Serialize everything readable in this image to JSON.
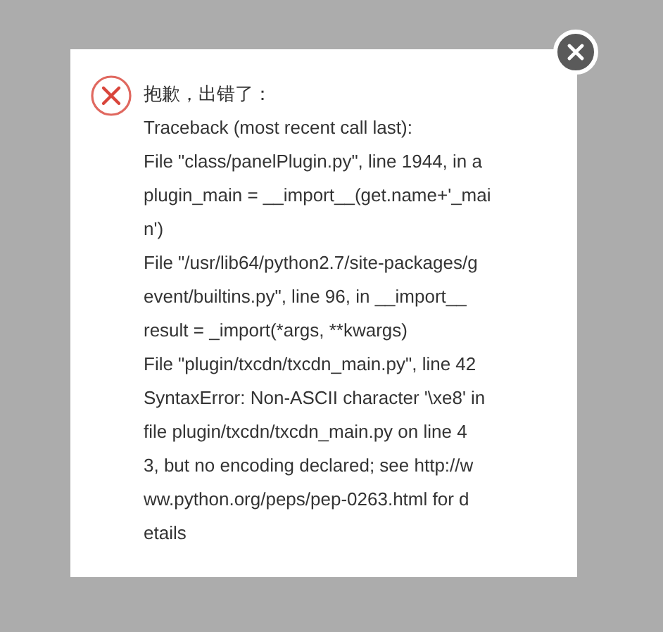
{
  "dialog": {
    "title": "抱歉，出错了：",
    "lines": [
      "Traceback (most recent call last):",
      "File \"class/panelPlugin.py\", line 1944, in a",
      "plugin_main = __import__(get.name+'_mai",
      "n')",
      "File \"/usr/lib64/python2.7/site-packages/g",
      "event/builtins.py\", line 96, in __import__",
      "result = _import(*args, **kwargs)",
      "File \"plugin/txcdn/txcdn_main.py\", line 42",
      "SyntaxError: Non-ASCII character '\\xe8' in",
      "file plugin/txcdn/txcdn_main.py on line 4",
      "3, but no encoding declared; see http://w",
      "ww.python.org/peps/pep-0263.html for d",
      "etails"
    ]
  }
}
